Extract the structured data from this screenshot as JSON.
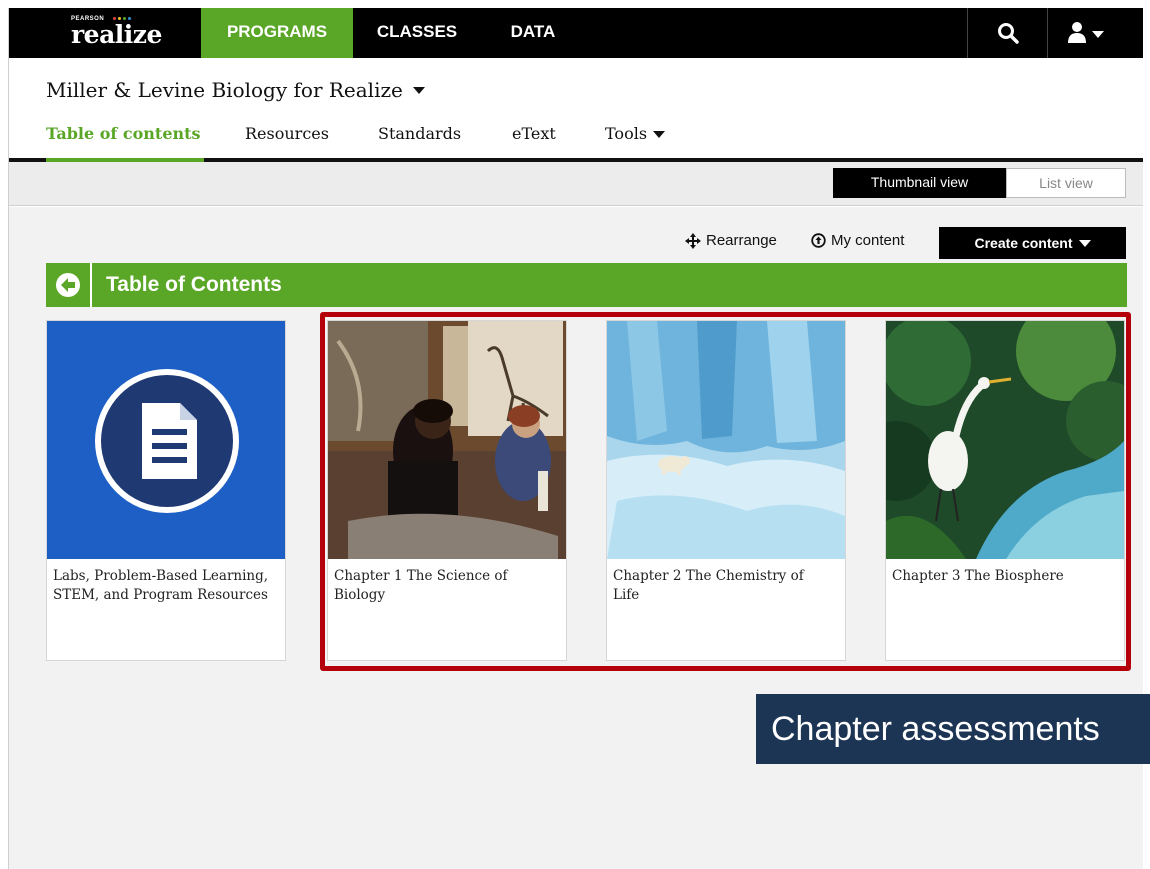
{
  "brand": {
    "publisher": "PEARSON",
    "product": "realize",
    "dot_colors": [
      "#e9433b",
      "#f3c623",
      "#5aa728",
      "#2f8fd5"
    ]
  },
  "topnav": {
    "tabs": [
      {
        "label": "PROGRAMS",
        "active": true
      },
      {
        "label": "CLASSES",
        "active": false
      },
      {
        "label": "DATA",
        "active": false
      }
    ],
    "search_icon": "search-icon",
    "user_icon": "user-menu-icon"
  },
  "program": {
    "title": "Miller & Levine Biology for Realize",
    "tabs": [
      {
        "label": "Table of contents",
        "active": true
      },
      {
        "label": "Resources",
        "active": false
      },
      {
        "label": "Standards",
        "active": false
      },
      {
        "label": "eText",
        "active": false
      },
      {
        "label": "Tools",
        "active": false
      }
    ]
  },
  "view_toggle": {
    "thumbnail": "Thumbnail view",
    "list": "List view",
    "selected": "Thumbnail view"
  },
  "actions": {
    "rearrange": "Rearrange",
    "my_content": "My content",
    "create": "Create content"
  },
  "toc": {
    "title": "Table of Contents"
  },
  "cards": [
    {
      "label": "Labs, Problem-Based Learning, STEM, and Program Resources",
      "thumb": "document-icon"
    },
    {
      "label": "Chapter 1 The Science of Biology",
      "thumb": "fossil-lab-photo"
    },
    {
      "label": "Chapter 2 The Chemistry of Life",
      "thumb": "glacier-polar-bear-photo"
    },
    {
      "label": "Chapter 3 The Biosphere",
      "thumb": "egret-stream-photo"
    }
  ],
  "callout": {
    "text": "Chapter assessments"
  },
  "colors": {
    "accent_green": "#5aa728",
    "highlight_red": "#b3000b",
    "callout_navy": "#1d3554",
    "doc_blue": "#1d5fc4"
  }
}
